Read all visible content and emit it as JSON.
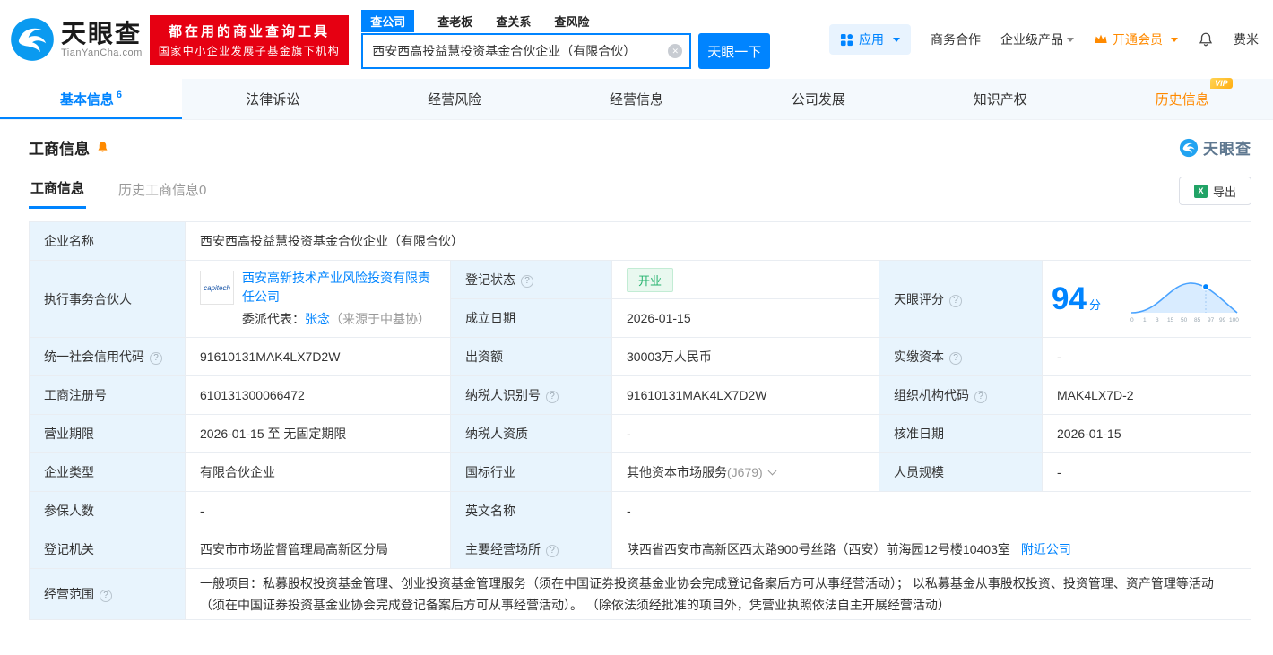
{
  "brand": {
    "logo_title": "天眼查",
    "logo_subtitle": "TianYanCha.com",
    "slogan_line1": "都在用的商业查询工具",
    "slogan_line2": "国家中小企业发展子基金旗下机构"
  },
  "search": {
    "tabs": [
      {
        "label": "查公司"
      },
      {
        "label": "查老板"
      },
      {
        "label": "查关系"
      },
      {
        "label": "查风险"
      }
    ],
    "value": "西安西高投益慧投资基金合伙企业（有限合伙）",
    "button_label": "天眼一下"
  },
  "header_right": {
    "app_label": "应用",
    "biz_label": "商务合作",
    "enterprise_label": "企业级产品",
    "vip_label": "开通会员",
    "user_label": "费米"
  },
  "nav_tabs": [
    {
      "label": "基本信息",
      "count": "6"
    },
    {
      "label": "法律诉讼"
    },
    {
      "label": "经营风险"
    },
    {
      "label": "经营信息"
    },
    {
      "label": "公司发展"
    },
    {
      "label": "知识产权"
    },
    {
      "label": "历史信息",
      "badge": "VIP"
    }
  ],
  "section": {
    "title": "工商信息",
    "watermark": "天眼查",
    "subtabs": [
      {
        "label": "工商信息"
      },
      {
        "label": "历史工商信息0"
      }
    ],
    "export_label": "导出"
  },
  "fields": {
    "company_name": {
      "label": "企业名称",
      "value": "西安西高投益慧投资基金合伙企业（有限合伙）"
    },
    "managing_partner": {
      "label": "执行事务合伙人",
      "company": "西安高新技术产业风险投资有限责任公司",
      "logo_text": "capitech",
      "rep_label": "委派代表：",
      "rep_name": "张念",
      "rep_source": "（来源于中基协）"
    },
    "reg_status": {
      "label": "登记状态",
      "value": "开业"
    },
    "establish_date": {
      "label": "成立日期",
      "value": "2026-01-15"
    },
    "score": {
      "label": "天眼评分",
      "value": "94",
      "unit": "分"
    },
    "credit_code": {
      "label": "统一社会信用代码",
      "value": "91610131MAK4LX7D2W"
    },
    "capital": {
      "label": "出资额",
      "value": "30003万人民币"
    },
    "paid_capital": {
      "label": "实缴资本",
      "value": "-"
    },
    "reg_number": {
      "label": "工商注册号",
      "value": "610131300066472"
    },
    "taxpayer_id": {
      "label": "纳税人识别号",
      "value": "91610131MAK4LX7D2W"
    },
    "org_code": {
      "label": "组织机构代码",
      "value": "MAK4LX7D-2"
    },
    "business_term": {
      "label": "营业期限",
      "value": "2026-01-15 至 无固定期限"
    },
    "taxpayer_quality": {
      "label": "纳税人资质",
      "value": "-"
    },
    "approval_date": {
      "label": "核准日期",
      "value": "2026-01-15"
    },
    "company_type": {
      "label": "企业类型",
      "value": "有限合伙企业"
    },
    "industry": {
      "label": "国标行业",
      "value": "其他资本市场服务",
      "code": "(J679)"
    },
    "staff_size": {
      "label": "人员规模",
      "value": "-"
    },
    "insured_count": {
      "label": "参保人数",
      "value": "-"
    },
    "english_name": {
      "label": "英文名称",
      "value": "-"
    },
    "reg_authority": {
      "label": "登记机关",
      "value": "西安市市场监督管理局高新区分局"
    },
    "premises": {
      "label": "主要经营场所",
      "value": "陕西省西安市高新区西太路900号丝路（西安）前海园12号楼10403室",
      "nearby_label": "附近公司"
    },
    "business_scope": {
      "label": "经营范围",
      "value": "一般项目：私募股权投资基金管理、创业投资基金管理服务（须在中国证券投资基金业协会完成登记备案后方可从事经营活动）； 以私募基金从事股权投资、投资管理、资产管理等活动（须在中国证券投资基金业协会完成登记备案后方可从事经营活动）。 （除依法须经批准的项目外，凭营业执照依法自主开展经营活动）"
    }
  },
  "score_chart": {
    "type": "line",
    "point_value": 94,
    "ticks": [
      "0",
      "1",
      "3",
      "15",
      "50",
      "85",
      "97",
      "99",
      "100"
    ]
  },
  "colors": {
    "brand_blue": "#0084ff",
    "slogan_red": "#e60012",
    "vip_orange": "#ff8a00",
    "status_green": "#23b26d",
    "label_cell_bg": "#e8f4fd"
  }
}
